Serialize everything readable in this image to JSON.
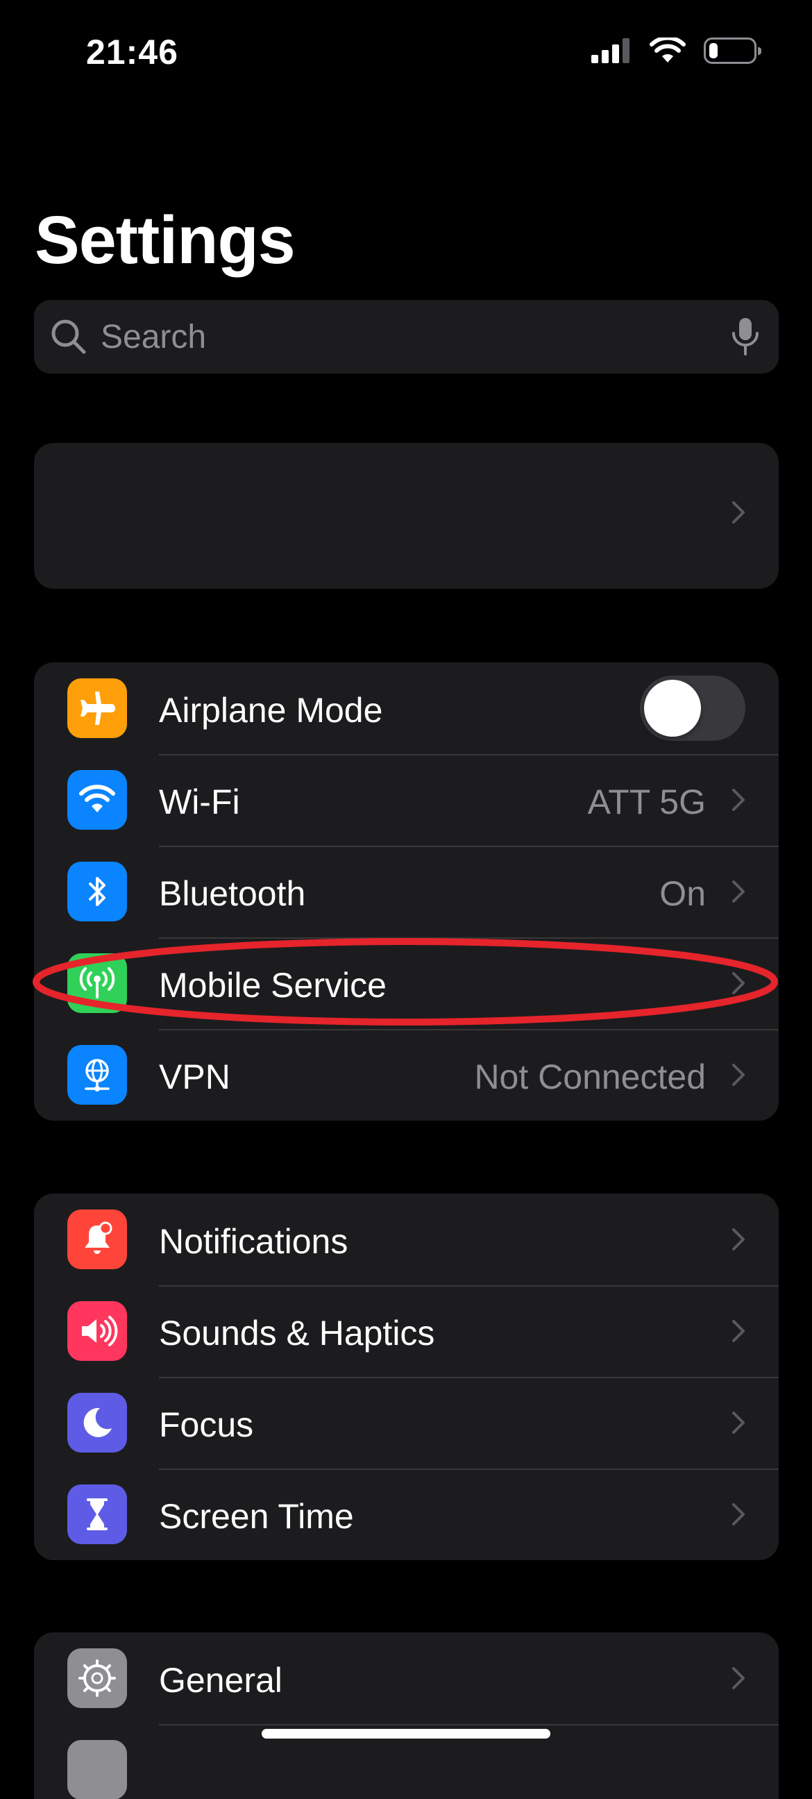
{
  "status_bar": {
    "time": "21:46",
    "battery_level": 0.2
  },
  "page_title": "Settings",
  "search": {
    "placeholder": "Search"
  },
  "groups": [
    {
      "rows": [
        {
          "label": "Airplane Mode",
          "icon": "airplane-icon",
          "color": "#ff9f0a",
          "toggle": false
        },
        {
          "label": "Wi-Fi",
          "icon": "wifi-icon",
          "color": "#0a84ff",
          "value": "ATT 5G"
        },
        {
          "label": "Bluetooth",
          "icon": "bluetooth-icon",
          "color": "#0a84ff",
          "value": "On"
        },
        {
          "label": "Mobile Service",
          "icon": "antenna-icon",
          "color": "#30d158",
          "value": ""
        },
        {
          "label": "VPN",
          "icon": "globe-icon",
          "color": "#0a84ff",
          "value": "Not Connected"
        }
      ]
    },
    {
      "rows": [
        {
          "label": "Notifications",
          "icon": "bell-icon",
          "color": "#ff453a"
        },
        {
          "label": "Sounds & Haptics",
          "icon": "speaker-icon",
          "color": "#ff375f"
        },
        {
          "label": "Focus",
          "icon": "moon-icon",
          "color": "#5e5ce6"
        },
        {
          "label": "Screen Time",
          "icon": "hourglass-icon",
          "color": "#5e5ce6"
        }
      ]
    },
    {
      "rows": [
        {
          "label": "General",
          "icon": "gear-icon",
          "color": "#8e8e93"
        }
      ]
    }
  ],
  "colors": {
    "background": "#000000",
    "cell": "#1c1c1e",
    "secondary_text": "#8e8e93",
    "annotation": "#e5242b"
  }
}
